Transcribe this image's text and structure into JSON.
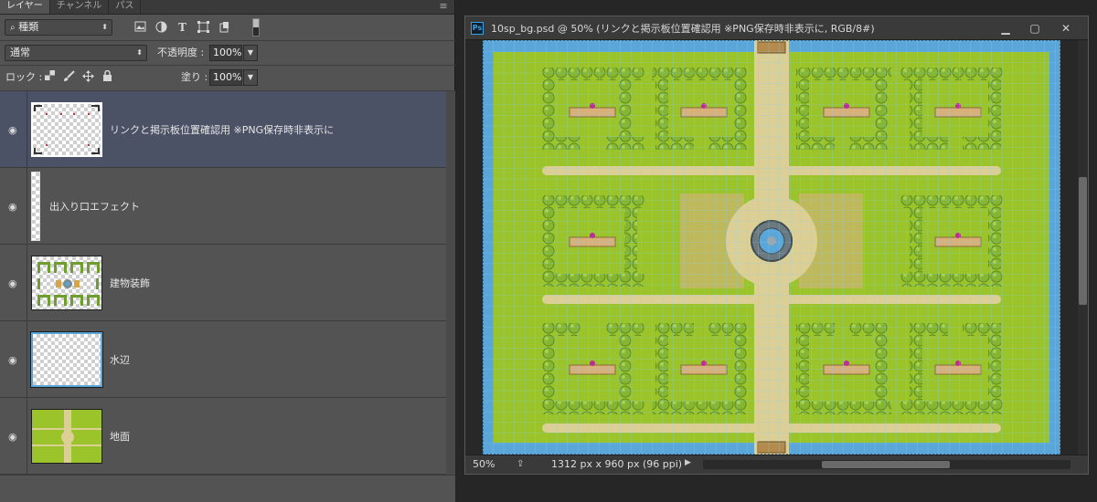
{
  "panel_tabs": [
    "レイヤー",
    "チャンネル",
    "パス"
  ],
  "filter": {
    "label": "種類"
  },
  "blend_mode": "通常",
  "opacity_label": "不透明度 :",
  "opacity_value": "100%",
  "lock_label": "ロック :",
  "fill_label": "塗り :",
  "fill_value": "100%",
  "layers": [
    {
      "name": "リンクと掲示板位置確認用  ※PNG保存時非表示に",
      "selected": true
    },
    {
      "name": "出入り口エフェクト",
      "selected": false
    },
    {
      "name": "建物装飾",
      "selected": false
    },
    {
      "name": "水辺",
      "selected": false
    },
    {
      "name": "地面",
      "selected": false
    }
  ],
  "document": {
    "title": "10sp_bg.psd @ 50% (リンクと掲示板位置確認用   ※PNG保存時非表示に, RGB/8#)",
    "ps_badge": "Ps",
    "zoom": "50%",
    "info": "1312 px x 960 px (96 ppi)"
  },
  "colors": {
    "grass": "#9ac42a",
    "water": "#5aa6d8",
    "path": "#dccf95",
    "hedge": "#7fb12e",
    "grid": "#7fd0ff"
  },
  "icons": [
    "search-icon",
    "image-filter-icon",
    "adjust-filter-icon",
    "type-filter-icon",
    "shape-filter-icon",
    "smart-filter-icon",
    "eye-icon",
    "lock-pixels-icon",
    "lock-paint-icon",
    "lock-move-icon",
    "lock-all-icon",
    "minimize-icon",
    "maximize-icon",
    "close-icon"
  ]
}
